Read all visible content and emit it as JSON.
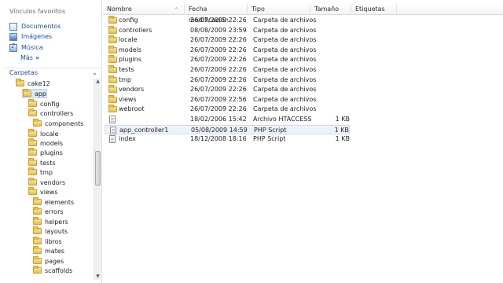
{
  "navigation": {
    "favorites_title": "Vínculos favoritos",
    "favorites": [
      {
        "label": "Documentos",
        "icon": "documents-icon"
      },
      {
        "label": "Imágenes",
        "icon": "pictures-icon"
      },
      {
        "label": "Música",
        "icon": "music-icon"
      }
    ],
    "more_label": "Más",
    "more_chevron": "»",
    "folders_header": "Carpetas",
    "folders_chevron": "⌄",
    "tree": [
      {
        "label": "cake12",
        "depth": 0
      },
      {
        "label": "app",
        "depth": 1,
        "selected": true
      },
      {
        "label": "config",
        "depth": 2
      },
      {
        "label": "controllers",
        "depth": 2
      },
      {
        "label": "components",
        "depth": 3
      },
      {
        "label": "locale",
        "depth": 2
      },
      {
        "label": "models",
        "depth": 2
      },
      {
        "label": "plugins",
        "depth": 2
      },
      {
        "label": "tests",
        "depth": 2
      },
      {
        "label": "tmp",
        "depth": 2
      },
      {
        "label": "vendors",
        "depth": 2
      },
      {
        "label": "views",
        "depth": 2
      },
      {
        "label": "elements",
        "depth": 3
      },
      {
        "label": "errors",
        "depth": 3
      },
      {
        "label": "helpers",
        "depth": 3
      },
      {
        "label": "layouts",
        "depth": 3
      },
      {
        "label": "libros",
        "depth": 3
      },
      {
        "label": "mates",
        "depth": 3
      },
      {
        "label": "pages",
        "depth": 3
      },
      {
        "label": "scaffolds",
        "depth": 3
      }
    ]
  },
  "file_list": {
    "columns": {
      "name": "Nombre",
      "modified": "Fecha modificación",
      "type": "Tipo",
      "size": "Tamaño",
      "tags": "Etiquetas"
    },
    "rows": [
      {
        "name": "config",
        "modified": "26/07/2009 22:26",
        "type": "Carpeta de archivos",
        "size": "",
        "kind": "folder"
      },
      {
        "name": "controllers",
        "modified": "08/08/2009 23:59",
        "type": "Carpeta de archivos",
        "size": "",
        "kind": "folder"
      },
      {
        "name": "locale",
        "modified": "26/07/2009 22:26",
        "type": "Carpeta de archivos",
        "size": "",
        "kind": "folder"
      },
      {
        "name": "models",
        "modified": "26/07/2009 22:26",
        "type": "Carpeta de archivos",
        "size": "",
        "kind": "folder"
      },
      {
        "name": "plugins",
        "modified": "26/07/2009 22:26",
        "type": "Carpeta de archivos",
        "size": "",
        "kind": "folder"
      },
      {
        "name": "tests",
        "modified": "26/07/2009 22:26",
        "type": "Carpeta de archivos",
        "size": "",
        "kind": "folder"
      },
      {
        "name": "tmp",
        "modified": "26/07/2009 22:26",
        "type": "Carpeta de archivos",
        "size": "",
        "kind": "folder"
      },
      {
        "name": "vendors",
        "modified": "26/07/2009 22:26",
        "type": "Carpeta de archivos",
        "size": "",
        "kind": "folder"
      },
      {
        "name": "views",
        "modified": "26/07/2009 22:56",
        "type": "Carpeta de archivos",
        "size": "",
        "kind": "folder"
      },
      {
        "name": "webroot",
        "modified": "26/07/2009 22:26",
        "type": "Carpeta de archivos",
        "size": "",
        "kind": "folder"
      },
      {
        "name": "",
        "modified": "18/02/2006 15:42",
        "type": "Archivo HTACCESS",
        "size": "1 KB",
        "kind": "file"
      },
      {
        "name": "app_controller1",
        "modified": "05/08/2009 14:59",
        "type": "PHP Script",
        "size": "1 KB",
        "kind": "file",
        "highlighted": true
      },
      {
        "name": "index",
        "modified": "18/12/2008 18:16",
        "type": "PHP Script",
        "size": "1 KB",
        "kind": "file"
      }
    ]
  },
  "colors": {
    "link_blue": "#1e4e9c",
    "selection": "#dbe9f7",
    "folder_yellow": "#e7be4f"
  }
}
